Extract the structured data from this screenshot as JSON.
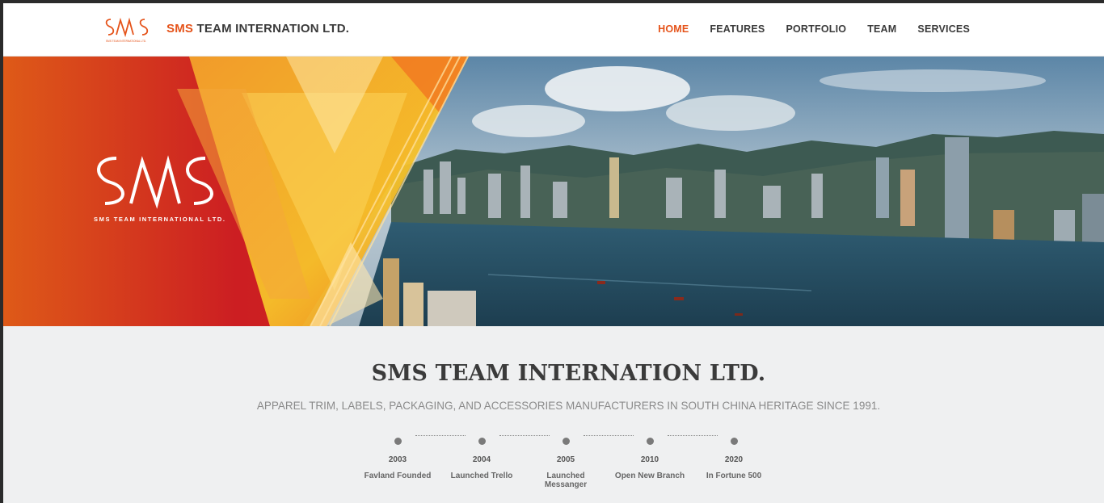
{
  "header": {
    "brand_accent": "SMS",
    "brand_rest": " TEAM INTERNATION LTD.",
    "logo_icon": "sms-monogram-logo",
    "nav": [
      {
        "label": "HOME",
        "active": true
      },
      {
        "label": "FEATURES",
        "active": false
      },
      {
        "label": "PORTFOLIO",
        "active": false
      },
      {
        "label": "TEAM",
        "active": false
      },
      {
        "label": "SERVICES",
        "active": false
      }
    ]
  },
  "hero": {
    "caption": "SMS TEAM INTERNATIONAL LTD.",
    "logo_icon": "sms-monogram-logo",
    "image": "harbor-city-skyline"
  },
  "main": {
    "title": "SMS TEAM INTERNATION LTD.",
    "subtitle": "APPAREL TRIM, LABELS, PACKAGING, AND ACCESSORIES MANUFACTURERS IN SOUTH CHINA HERITAGE SINCE 1991."
  },
  "timeline": [
    {
      "year": "2003",
      "label": "Favland Founded"
    },
    {
      "year": "2004",
      "label": "Launched Trello"
    },
    {
      "year": "2005",
      "label": "Launched Messanger"
    },
    {
      "year": "2010",
      "label": "Open New Branch"
    },
    {
      "year": "2020",
      "label": "In Fortune 500"
    }
  ],
  "colors": {
    "accent": "#e5531a",
    "text_dark": "#3a3a3a",
    "section_bg": "#eff0f1"
  }
}
